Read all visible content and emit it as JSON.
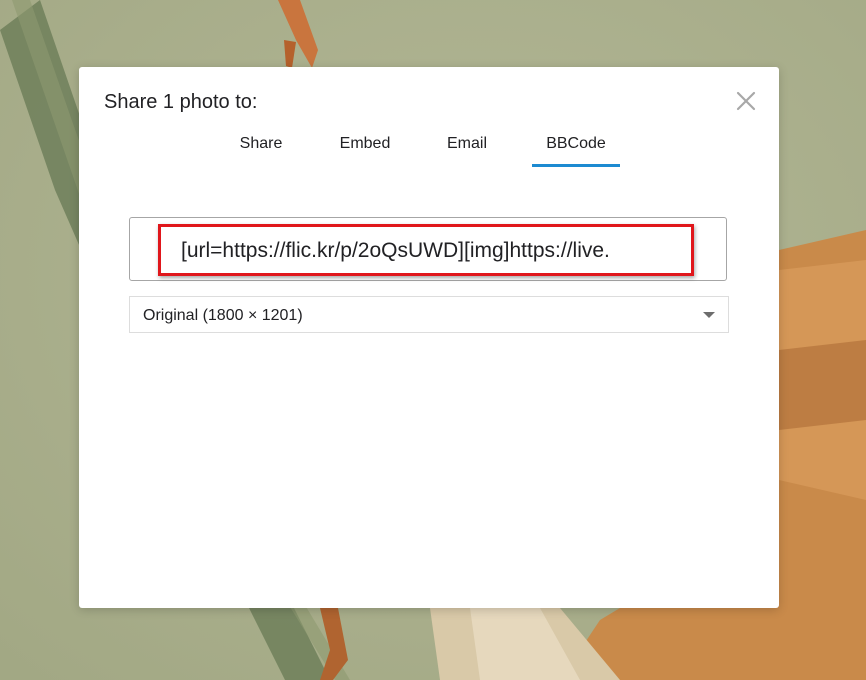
{
  "dialog": {
    "title": "Share 1 photo to:",
    "tabs": [
      {
        "label": "Share",
        "active": false
      },
      {
        "label": "Embed",
        "active": false
      },
      {
        "label": "Email",
        "active": false
      },
      {
        "label": "BBCode",
        "active": true
      }
    ],
    "bbcode_value": "[url=https://flic.kr/p/2oQsUWD][img]https://live.",
    "size_select": {
      "selected": "Original (1800 × 1201)"
    },
    "close_icon": "close-icon"
  },
  "colors": {
    "accent": "#1c8ad1",
    "highlight": "#e0161b",
    "backdrop": "#a9ae8c"
  }
}
